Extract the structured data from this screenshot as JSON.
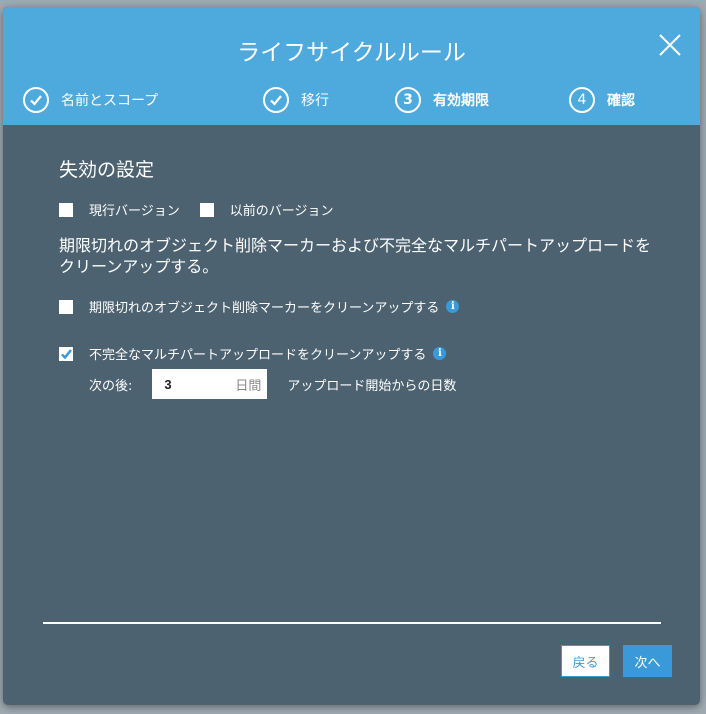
{
  "modal": {
    "title": "ライフサイクルルール",
    "steps": [
      {
        "num": "1",
        "label": "名前とスコープ",
        "state": "done"
      },
      {
        "num": "2",
        "label": "移行",
        "state": "done"
      },
      {
        "num": "3",
        "label": "有効期限",
        "state": "active"
      },
      {
        "num": "4",
        "label": "確認",
        "state": "pending"
      }
    ],
    "section_title": "失効の設定",
    "current_version_label": "現行バージョン",
    "previous_version_label": "以前のバージョン",
    "cleanup_description": "期限切れのオブジェクト削除マーカーおよび不完全なマルチパートアップロードをクリーンアップする。",
    "expired_marker_label": "期限切れのオブジェクト削除マーカーをクリーンアップする",
    "incomplete_upload_label": "不完全なマルチパートアップロードをクリーンアップする",
    "after_label": "次の後:",
    "days_value": "3",
    "days_unit": "日間",
    "days_description": "アップロード開始からの日数",
    "back_label": "戻る",
    "next_label": "次へ"
  },
  "colors": {
    "header": "#4ea9dd",
    "body": "#4d6270",
    "accent": "#3a9ad9"
  }
}
